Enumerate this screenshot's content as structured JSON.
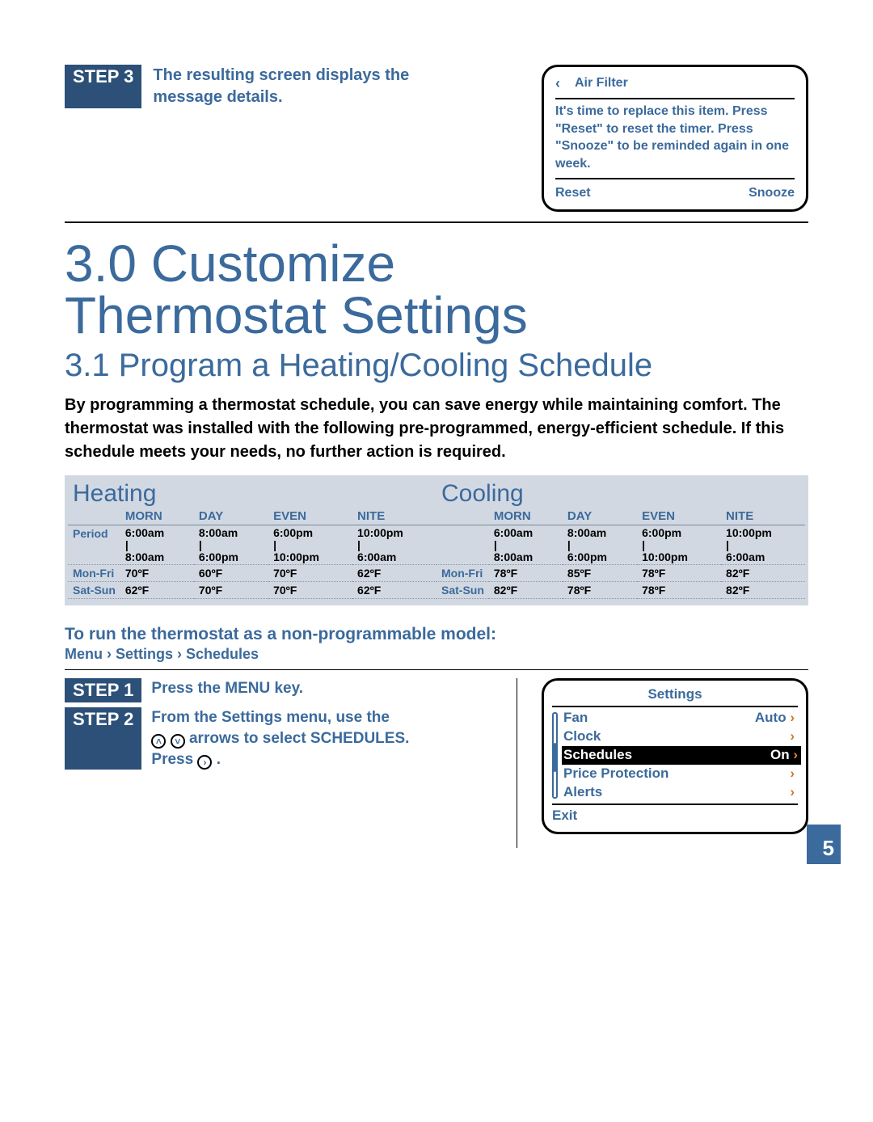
{
  "top_step": {
    "badge": "STEP 3",
    "text": "The resulting screen displays the message details."
  },
  "air_filter": {
    "back_icon": "‹",
    "title": "Air Filter",
    "message": "It's time to replace this item. Press \"Reset\" to reset the timer. Press \"Snooze\" to be reminded again in one week.",
    "reset": "Reset",
    "snooze": "Snooze"
  },
  "chapter_title_line1": "3.0 Customize",
  "chapter_title_line2": "Thermostat Settings",
  "section_title": "3.1 Program a Heating/Cooling Schedule",
  "intro_body": "By programming a thermostat schedule, you can save energy while maintaining comfort. The thermostat was installed with the following pre-programmed, energy-efficient schedule. If this schedule meets your needs, no further action is required.",
  "schedule": {
    "heating_label": "Heating",
    "cooling_label": "Cooling",
    "columns": [
      "MORN",
      "DAY",
      "EVEN",
      "NITE"
    ],
    "heating": {
      "period": [
        "6:00am\n|\n8:00am",
        "8:00am\n|\n6:00pm",
        "6:00pm\n|\n10:00pm",
        "10:00pm\n|\n6:00am"
      ],
      "mon_fri": [
        "70ºF",
        "60ºF",
        "70ºF",
        "62ºF"
      ],
      "sat_sun": [
        "62ºF",
        "70ºF",
        "70ºF",
        "62ºF"
      ]
    },
    "cooling": {
      "period": [
        "6:00am\n|\n8:00am",
        "8:00am\n|\n6:00pm",
        "6:00pm\n|\n10:00pm",
        "10:00pm\n|\n6:00am"
      ],
      "mon_fri": [
        "78ºF",
        "85ºF",
        "78ºF",
        "82ºF"
      ],
      "sat_sun": [
        "82ºF",
        "78ºF",
        "78ºF",
        "82ºF"
      ]
    },
    "row_period": "Period",
    "row_monfri": "Mon-Fri",
    "row_satsun": "Sat-Sun"
  },
  "nonpg_title": "To run the thermostat as a non-programmable model:",
  "nonpg_path": "Menu › Settings › Schedules",
  "step1": {
    "badge": "STEP 1",
    "text": "Press the MENU key."
  },
  "step2": {
    "badge": "STEP 2",
    "text_a": "From the Settings menu, use the",
    "text_b": "arrows to select SCHEDULES.",
    "text_c": "Press"
  },
  "settings_panel": {
    "title": "Settings",
    "rows": [
      {
        "label": "Fan",
        "value": "Auto"
      },
      {
        "label": "Clock",
        "value": ""
      },
      {
        "label": "Schedules",
        "value": "On",
        "selected": true
      },
      {
        "label": "Price Protection",
        "value": ""
      },
      {
        "label": "Alerts",
        "value": ""
      }
    ],
    "exit": "Exit"
  },
  "page_number": "5"
}
